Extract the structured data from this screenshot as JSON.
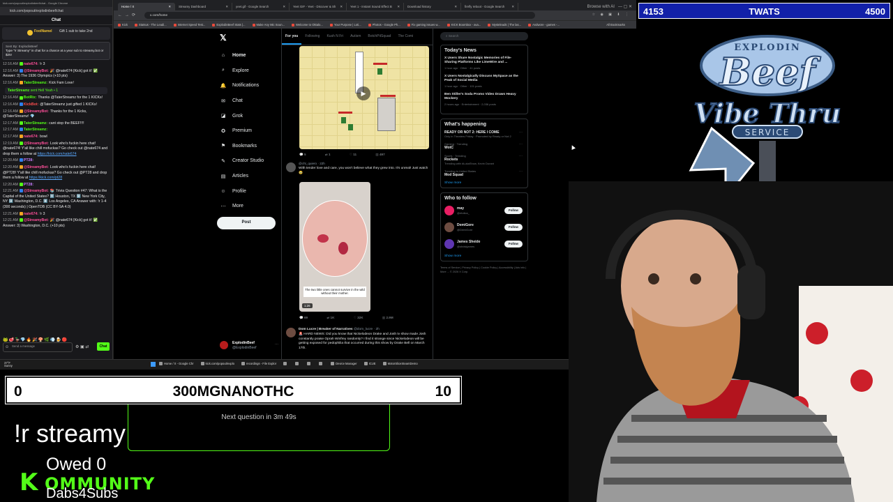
{
  "overlay": {
    "top_scoreboard": {
      "left": "4153",
      "center": "TWATS",
      "right": "4500"
    },
    "bottom_scoreboard": {
      "left": "0",
      "center": "300MGNANOTHC",
      "right": "10"
    },
    "trivia_timer": "Next question in 3m 49s",
    "command": "!r streamy",
    "owed": "Owed 0",
    "kommunity_k": "K",
    "kommunity_rest": "OMMUNITY",
    "dabs": "Dabs4Subs",
    "logo": {
      "top": "EXPLODIN",
      "main": "Beef",
      "sub": "Vibe Thru",
      "service": "SERVICE"
    }
  },
  "chat_window": {
    "title": "kick.com/popout/explodinbeef/chat - Google Chrome",
    "url": "kick.com/popout/explodinbeef/chat",
    "header": "Chat",
    "gift_user": "FoolNameI",
    "gift_text": "Gift 1 sub to take 2nd",
    "pinned_by": "Sent By: ExplodinBeef",
    "pinned_text": "Type \"!r Streamy\" in chat for a chance at a year sub to streamy.bot or $25!",
    "messages": [
      {
        "time": "12:16 AM",
        "user": "nate674:",
        "color": "#ff4f9a",
        "text": "!r 3"
      },
      {
        "time": "12:16 AM",
        "user": "@StreamyBot:",
        "color": "#ff4f9a",
        "text": "🎉 @nate674 [Kick] got it! ✅ Answer: 3) The 1936 Olympics (+10 pts)"
      },
      {
        "time": "12:16 AM",
        "user": "TaterStreamz:",
        "color": "#53fc18",
        "text": "Kick Fam Love!"
      },
      {
        "time": "12:16 AM",
        "user": "BotRix:",
        "color": "#53fc18",
        "text": "Thanks @TaterStreamz for the 1 KICKs!"
      },
      {
        "time": "12:16 AM",
        "user": "KickBot:",
        "color": "#ff4f4f",
        "text": "@TaterStreamz just gifted 1 KICKs!"
      },
      {
        "time": "12:16 AM",
        "user": "@StreamyBot:",
        "color": "#ff4f9a",
        "text": "Thanks for the 1 Kicks, @TaterStreamz! 💎"
      },
      {
        "time": "12:17 AM",
        "user": "TaterStreamz:",
        "color": "#53fc18",
        "text": "cant stop the BEEF!!!!"
      },
      {
        "time": "12:17 AM",
        "user": "TaterStreamz:",
        "color": "#53fc18",
        "text": ""
      },
      {
        "time": "12:17 AM",
        "user": "nate674:",
        "color": "#ff4f9a",
        "text": "bowl"
      },
      {
        "time": "12:19 AM",
        "user": "@StreamyBot:",
        "color": "#ff4f9a",
        "text": "Look who's fuckin here chat! @nate674! Y'all like chill mofuckas? Go check out @nate674 and drop them a follow at",
        "link": "https://kick.com/nate674"
      },
      {
        "time": "12:20 AM",
        "user": "PT28:",
        "color": "#c77dff",
        "text": ""
      },
      {
        "time": "12:20 AM",
        "user": "@StreamyBot:",
        "color": "#ff4f9a",
        "text": "Look who's fuckin here chat! @PT28! Y'all like chill mofuckas? Go check out @PT28 and drop them a follow at",
        "link": "https://kick.com/pt28"
      },
      {
        "time": "12:20 AM",
        "user": "PT28:",
        "color": "#c77dff",
        "text": ""
      },
      {
        "time": "12:21 AM",
        "user": "@StreamyBot:",
        "color": "#ff4f9a",
        "text": "📚 Trivia Question #47: What is the Capital of the United States? 1️⃣ Houston, TX 2️⃣ New York City, NY 3️⃣ Washington, D.C. 4️⃣ Los Angeles, CA Answer with: !r 1-4 (300 seconds) | OpenTDB (CC BY-SA 4.0)"
      },
      {
        "time": "12:21 AM",
        "user": "nate674:",
        "color": "#ff4f9a",
        "text": "!r 3"
      },
      {
        "time": "12:21 AM",
        "user": "@StreamyBot:",
        "color": "#ff4f9a",
        "text": "🎉 @nate674 [Kick] got it! ✅ Answer: 3) Washington, D.C. (+10 pts)"
      }
    ],
    "system_notice": {
      "user": "TaterStreamz",
      "text": "sent Hell Yeah",
      "count": "1"
    },
    "input_placeholder": "Send a message",
    "send_label": "Chat"
  },
  "browser": {
    "tabs": [
      {
        "label": "Home / X"
      },
      {
        "label": "Streamy Dashboard"
      },
      {
        "label": "yeet.gif - Google Search"
      },
      {
        "label": "Yeet GIF - Yeet - Discover & Sh"
      },
      {
        "label": "Yeet 1 - Instant Sound Effect B"
      },
      {
        "label": "Download history"
      },
      {
        "label": "firefly reboot - Google Search"
      }
    ],
    "tab_extra": "Browse with AI",
    "address": "x.com/home",
    "bookmarks": [
      "Kick",
      "Statsus - The Leadi...",
      "Internet Speed Test...",
      "ExplodinBeef Stats |...",
      "Make Any Mic Soun...",
      "Welcome to Oktalo...",
      "Your Purpose | Loti...",
      "Photos - Google Ph...",
      "Fix gaming issues w...",
      "KICK Boombox - ava...",
      "Mysteleads | The las...",
      "Andwore - games -..."
    ],
    "all_bookmarks": "All Bookmarks"
  },
  "x": {
    "logo": "𝕏",
    "nav": [
      {
        "icon": "⌂",
        "label": "Home"
      },
      {
        "icon": "⌕",
        "label": "Explore"
      },
      {
        "icon": "🔔",
        "label": "Notifications"
      },
      {
        "icon": "✉",
        "label": "Chat"
      },
      {
        "icon": "◪",
        "label": "Grok"
      },
      {
        "icon": "✪",
        "label": "Premium"
      },
      {
        "icon": "⚑",
        "label": "Bookmarks"
      },
      {
        "icon": "✎",
        "label": "Creator Studio"
      },
      {
        "icon": "▤",
        "label": "Articles"
      },
      {
        "icon": "☺",
        "label": "Profile"
      },
      {
        "icon": "⋯",
        "label": "More"
      }
    ],
    "post_button": "Post",
    "profile": {
      "name": "ExplodinBeef",
      "handle": "@ExplodinBeef"
    },
    "feed_tabs": [
      "For you",
      "Following",
      "Kush N Fri",
      "Autism",
      "BotchPitSquad",
      "The Comi"
    ],
    "tweet1_actions": {
      "replies": "5",
      "reposts": "1",
      "likes": "11",
      "views": "497"
    },
    "tweet2": {
      "meta": "@cht_quiero · 22h",
      "text": "With tender love and care, you won't believe what they grew into. It's unreal! Just watch 🥹",
      "caption": "The two little ones cannot survive in the wild without their mother.",
      "duration": "1:26",
      "actions": {
        "replies": "69",
        "reposts": "1K",
        "likes": "32K",
        "views": "2.9M"
      }
    },
    "tweet3": {
      "name": "Dom Lucre | Breaker of Narratives",
      "meta": "@dom_lucre · 2h",
      "text": "🚨 HARD NEWS: Did you know that Nickelodeon Drake and Josh tv show made Josh constantly praise Oprah Winfrey randomly? I find it strange since Nickelodeon will be getting exposed for pedophilia that occurred during this show by Drake Bell on March 17th."
    },
    "search_placeholder": "Search",
    "news_title": "Today's News",
    "news": [
      {
        "headline": "X Users Share Nostalgic Memories of File-Sharing Platforms Like LimeWire and ...",
        "meta": "1 hour ago · Other · 41 posts"
      },
      {
        "headline": "X Users Nostalgically Discuss MySpace as the Peak of Social Media",
        "meta": "1 hour ago · Other · 101 posts"
      },
      {
        "headline": "Ben Stiller's Soda Promo Video Draws Heavy Mockery",
        "meta": "2 hours ago · Entertainment · 2,036 posts"
      }
    ],
    "happening_title": "What's happening",
    "trends": [
      {
        "category": "",
        "name": "READY OR NOT 2: HERE I COME",
        "sub": "Only in Theaters Friday · Promoted by Ready or Not 2"
      },
      {
        "category": "Gaming · Trending",
        "name": "WotC",
        "sub": ""
      },
      {
        "category": "Sports · Trending",
        "name": "Rockets",
        "sub": "Trending with #LukaShow, Kevin Durant"
      },
      {
        "category": "Trending in United States",
        "name": "Mod Squad",
        "sub": ""
      }
    ],
    "show_more": "Show more",
    "wtf_title": "Who to follow",
    "wtf": [
      {
        "name": "may",
        "handle": "@etolica_",
        "color": "#e91e63"
      },
      {
        "name": "DemiGore",
        "handle": "@DemiGore",
        "color": "#6d4c41"
      },
      {
        "name": "James Sheide",
        "handle": "@shdskjames",
        "color": "#5e35b1"
      }
    ],
    "follow_label": "Follow",
    "footer": "Terms of Service | Privacy Policy | Cookie Policy | Accessibility | Ads info | More ... © 2026 X Corp."
  },
  "taskbar": {
    "weather_temp": "37°F",
    "weather_cond": "Sunny",
    "apps": [
      "Home / X - Google Chr",
      "kick.com/popout/explo",
      "recordings - File Explor",
      "",
      "",
      "",
      "",
      "Device Manager",
      "ICUE",
      "MotorSliceSteamDemo"
    ]
  }
}
